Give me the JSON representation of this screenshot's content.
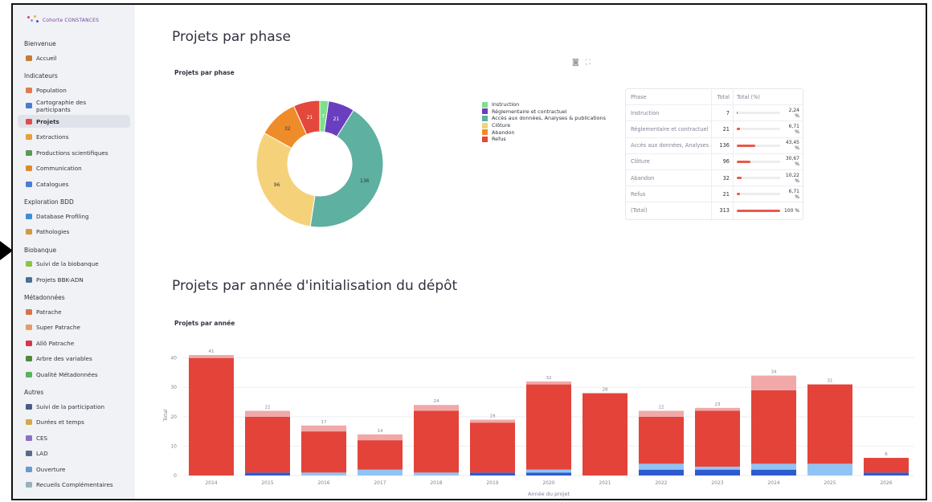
{
  "sidebar": {
    "logo_text": "Cohorte CONSTANCES",
    "sections": [
      {
        "title": "Bienvenue",
        "items": [
          {
            "label": "Accueil",
            "icon": "house-icon",
            "color": "#c77b30"
          }
        ]
      },
      {
        "title": "Indicateurs",
        "items": [
          {
            "label": "Population",
            "icon": "people-icon",
            "color": "#e07a50"
          },
          {
            "label": "Cartographie des participants",
            "icon": "map-icon",
            "color": "#4b7bd0"
          },
          {
            "label": "Projets",
            "icon": "pen-icon",
            "color": "#e54b4b",
            "active": true
          },
          {
            "label": "Extractions",
            "icon": "truck-icon",
            "color": "#e8a030"
          },
          {
            "label": "Productions scientifiques",
            "icon": "books-icon",
            "color": "#5a9a55"
          },
          {
            "label": "Communication",
            "icon": "megaphone-icon",
            "color": "#e08a2a"
          },
          {
            "label": "Catalogues",
            "icon": "magnifier-icon",
            "color": "#4a7dd9"
          }
        ]
      },
      {
        "title": "Exploration BDD",
        "items": [
          {
            "label": "Database Profiling",
            "icon": "cube-icon",
            "color": "#3d8fd6"
          },
          {
            "label": "Pathologies",
            "icon": "virus-icon",
            "color": "#d49a3a"
          }
        ]
      },
      {
        "title": "Biobanque",
        "items": [
          {
            "label": "Suivi de la biobanque",
            "icon": "pipette-icon",
            "color": "#8bc34a"
          },
          {
            "label": "Projets BBK-ADN",
            "icon": "microscope-icon",
            "color": "#4a6e9a"
          }
        ]
      },
      {
        "title": "Métadonnées",
        "items": [
          {
            "label": "Patrache",
            "icon": "dog-icon",
            "color": "#d9724a"
          },
          {
            "label": "Super Patrache",
            "icon": "dog2-icon",
            "color": "#e59a6a"
          },
          {
            "label": "Allô Patrache",
            "icon": "phone-icon",
            "color": "#d9344a"
          },
          {
            "label": "Arbre des variables",
            "icon": "tree-icon",
            "color": "#4f8a3a"
          },
          {
            "label": "Qualité Métadonnées",
            "icon": "check-icon",
            "color": "#57b45a"
          }
        ]
      },
      {
        "title": "Autres",
        "items": [
          {
            "label": "Suivi de la participation",
            "icon": "family-icon",
            "color": "#4a5a8a"
          },
          {
            "label": "Durées et temps",
            "icon": "hourglass-icon",
            "color": "#d6a84a"
          },
          {
            "label": "CES",
            "icon": "chart-icon",
            "color": "#8a70c0"
          },
          {
            "label": "LAD",
            "icon": "robot-icon",
            "color": "#5a6a8a"
          },
          {
            "label": "Ouverture",
            "icon": "folder-icon",
            "color": "#6a9ad0"
          },
          {
            "label": "Recueils Complémentaires",
            "icon": "flask-icon",
            "color": "#9ab0c0"
          }
        ]
      }
    ]
  },
  "main": {
    "title1": "Projets par phase",
    "title2": "Projets par année d'initialisation du dépôt",
    "table": {
      "headers": [
        "Phase",
        "Total",
        "Total (%)"
      ],
      "rows": [
        {
          "phase": "Instruction",
          "total": "7",
          "pct": "2,24 %",
          "frac": 0.0224
        },
        {
          "phase": "Réglementaire et contractuel",
          "total": "21",
          "pct": "6,71 %",
          "frac": 0.0671
        },
        {
          "phase": "Accès aux données, Analyses &",
          "total": "136",
          "pct": "43,45 %",
          "frac": 0.4345
        },
        {
          "phase": "Clôture",
          "total": "96",
          "pct": "30,67 %",
          "frac": 0.3067
        },
        {
          "phase": "Abandon",
          "total": "32",
          "pct": "10,22 %",
          "frac": 0.1022
        },
        {
          "phase": "Refus",
          "total": "21",
          "pct": "6,71 %",
          "frac": 0.0671
        },
        {
          "phase": "(Total)",
          "total": "313",
          "pct": "100 %",
          "frac": 1.0
        }
      ]
    }
  },
  "chart_data": [
    {
      "type": "pie",
      "title": "Projets par phase",
      "labels": [
        "Instruction",
        "Réglementaire et contractuel",
        "Accès aux données, Analyses & publications",
        "Clôture",
        "Abandon",
        "Refus"
      ],
      "values": [
        7,
        21,
        136,
        96,
        32,
        21
      ],
      "colors": [
        "#7ee08a",
        "#6a3fbf",
        "#5eb0a0",
        "#f5d27a",
        "#ef8c2a",
        "#e4473b"
      ],
      "hole": 0.5,
      "legend": "right"
    },
    {
      "type": "bar",
      "title": "Projets par année",
      "xlabel": "Année du projet",
      "ylabel": "Total",
      "ylim": [
        0,
        41
      ],
      "yticks": [
        0,
        10,
        20,
        30,
        40
      ],
      "categories": [
        "2014",
        "2015",
        "2016",
        "2017",
        "2018",
        "2019",
        "2020",
        "2021",
        "2022",
        "2023",
        "2024",
        "2025",
        "2026"
      ],
      "totals": [
        41,
        22,
        17,
        14,
        24,
        19,
        32,
        28,
        22,
        23,
        34,
        31,
        6
      ],
      "series": [
        {
          "values": [
            0,
            1,
            0,
            0,
            0,
            1,
            1,
            0,
            2,
            2,
            2,
            0,
            1
          ],
          "color": "#2f5bd0"
        },
        {
          "values": [
            0,
            0,
            1,
            2,
            1,
            0,
            1,
            0,
            2,
            1,
            2,
            4,
            0
          ],
          "color": "#90c4f5"
        },
        {
          "values": [
            40,
            19,
            14,
            10,
            21,
            17,
            29,
            28,
            16,
            19,
            25,
            27,
            5
          ],
          "color": "#e4433a"
        },
        {
          "values": [
            1,
            2,
            2,
            2,
            2,
            1,
            1,
            0,
            2,
            1,
            5,
            0,
            0
          ],
          "color": "#f0a8a8"
        }
      ]
    }
  ]
}
